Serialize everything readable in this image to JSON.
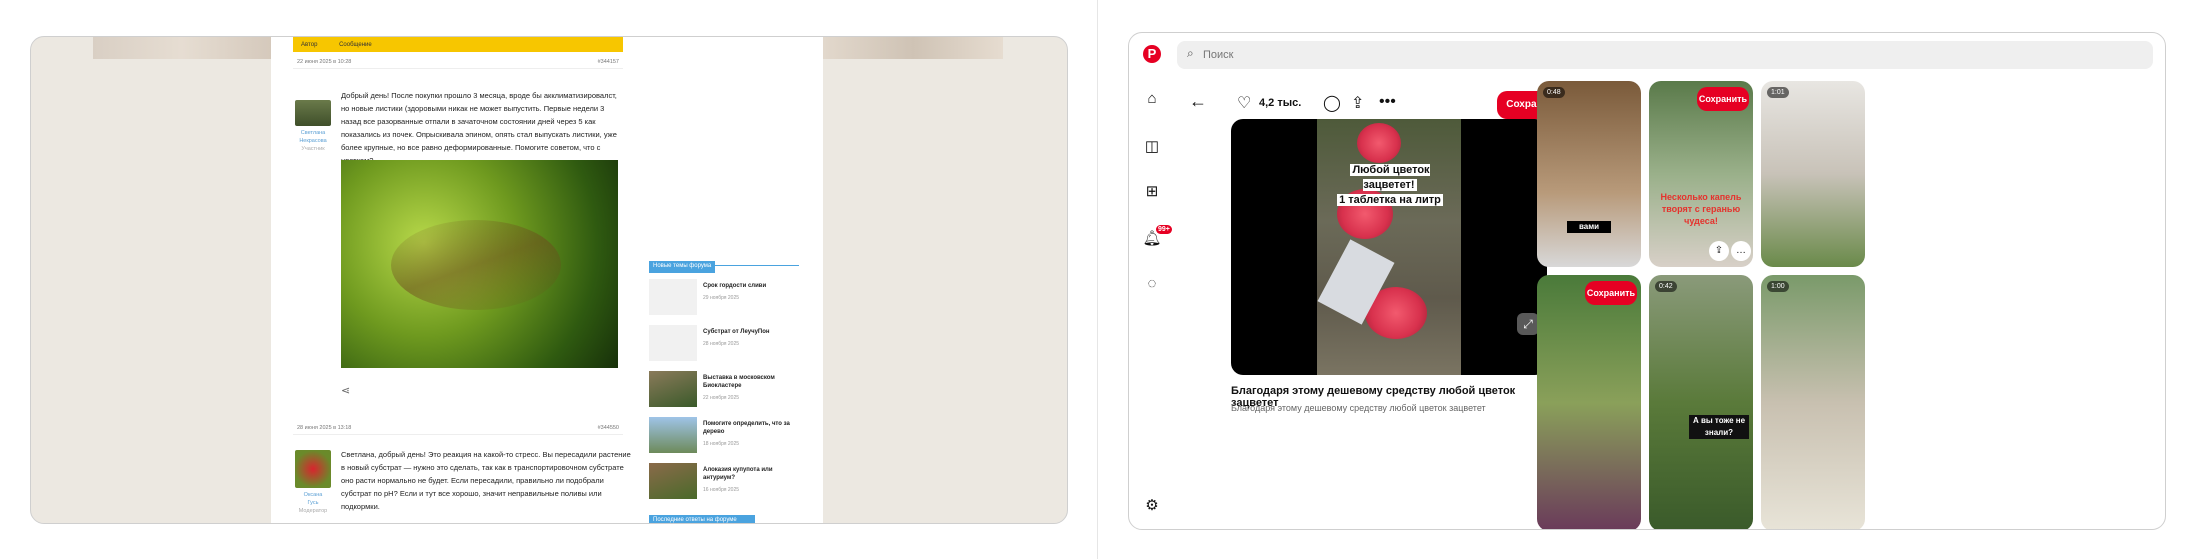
{
  "left": {
    "forum_header": {
      "author_col": "Автор",
      "message_col": "Сообщение"
    },
    "post1": {
      "date": "22 июня 2025 в 10:28",
      "num": "#344157",
      "user_lines": [
        "Светлана",
        "Некрасова",
        "Участник"
      ],
      "text": "Добрый день! После покупки прошло 3 месяца, вроде бы акклиматизировалст, но новые листики (здоровыми никак не может выпустить. Первые недели 3 назад все разорванные отпали в зачаточном состоянии дней через 5 как показались из почек. Опрыскивала эпином, опять стал выпускать листики, уже более крупные, но все равно деформированные. Помогите советом, что с цветком?"
    },
    "post2": {
      "date": "28 июня 2025 в 13:18",
      "num": "#344550",
      "user_lines": [
        "Оксана",
        "Гусь",
        "Модератор"
      ],
      "text": "Светлана, добрый день! Это реакция на какой-то стресс. Вы пересадили растение в новый субстрат — нужно это сделать, так как в транспортировочном субстрате оно расти нормально не будет. Если пересадили, правильно ли подобрали субстрат по pH? Если и тут все хорошо, значит неправильные поливы или подкормки."
    },
    "sidebar": {
      "heading": "Новые темы форума",
      "topics": [
        {
          "title": "Срок гордости сливи",
          "date": "29 ноября 2025"
        },
        {
          "title": "Субстрат от ЛеучуПон",
          "date": "28 ноября 2025"
        },
        {
          "title": "Выставка в московском Биокластере",
          "date": "22 ноября 2025"
        },
        {
          "title": "Помогите определить, что за дерево",
          "date": "18 ноября 2025"
        },
        {
          "title": "Алоказия купупота или антуриум?",
          "date": "16 ноября 2025"
        }
      ],
      "footer": "Последние ответы на форуме"
    }
  },
  "right": {
    "search": {
      "placeholder": "Поиск"
    },
    "badge": "99+",
    "pin": {
      "likes": "4,2 тыс.",
      "save_label": "Сохранить",
      "caption_line1": "Любой цветок зацветет!",
      "caption_line2": "1 таблетка на литр",
      "title": "Благодаря этому дешевому средству любой цветок зацветет",
      "description": "Благодаря этому дешевому средству любой цветок зацветет"
    },
    "grid": [
      {
        "duration": "0:48",
        "overlay": "вами"
      },
      {
        "save_label": "Сохранить",
        "overlay": "Несколько капель творят с геранью чудеса!"
      },
      {
        "duration": "1:01"
      },
      {
        "save_label": "Сохранить"
      },
      {
        "duration": "0:42",
        "overlay": "А вы тоже не знали?"
      },
      {
        "duration": "1:00"
      }
    ]
  }
}
